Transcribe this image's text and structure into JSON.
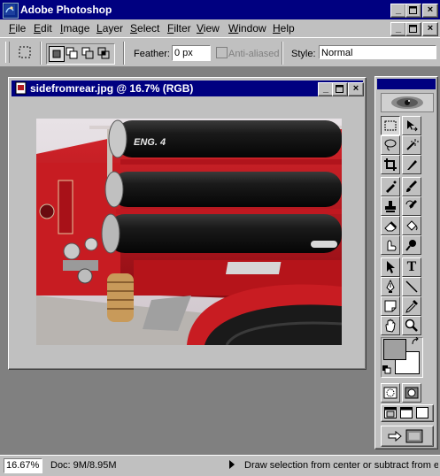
{
  "app": {
    "title": "Adobe Photoshop"
  },
  "menu": {
    "items": [
      {
        "label": "File",
        "key": "F",
        "rest": "ile"
      },
      {
        "label": "Edit",
        "key": "E",
        "rest": "dit"
      },
      {
        "label": "Image",
        "key": "I",
        "rest": "mage"
      },
      {
        "label": "Layer",
        "key": "L",
        "rest": "ayer"
      },
      {
        "label": "Select",
        "key": "S",
        "rest": "elect"
      },
      {
        "label": "Filter",
        "key": "F",
        "rest": "ilter"
      },
      {
        "label": "View",
        "key": "V",
        "rest": "iew"
      },
      {
        "label": "Window",
        "key": "W",
        "rest": "indow"
      },
      {
        "label": "Help",
        "key": "H",
        "rest": "elp"
      }
    ]
  },
  "options": {
    "feather_label": "Feather:",
    "feather_value": "0 px",
    "antialiased_label": "Anti-aliased",
    "style_label": "Style:",
    "style_value": "Normal"
  },
  "document": {
    "title": "sidefromrear.jpg @ 16.7% (RGB)",
    "image_text": "ENG. 4"
  },
  "toolbox": {
    "tools": [
      "rectangular-marquee-tool",
      "move-tool",
      "lasso-tool",
      "magic-wand-tool",
      "crop-tool",
      "slice-tool",
      "airbrush-tool",
      "paintbrush-tool",
      "clone-stamp-tool",
      "history-brush-tool",
      "eraser-tool",
      "paint-bucket-tool",
      "smudge-tool",
      "dodge-tool",
      "path-selection-tool",
      "type-tool",
      "pen-tool",
      "line-tool",
      "notes-tool",
      "eyedropper-tool",
      "hand-tool",
      "zoom-tool"
    ],
    "foreground_color": "#a0a0a0",
    "background_color": "#ffffff",
    "type_glyph": "T"
  },
  "status": {
    "zoom": "16.67%",
    "doc_info": "Doc: 9M/8.95M",
    "hint": "Draw selection from center or subtract from ex"
  },
  "colors": {
    "titlebar": "#000080",
    "chrome": "#c0c0c0",
    "workspace": "#808080"
  }
}
